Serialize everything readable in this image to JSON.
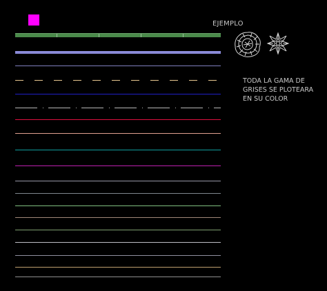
{
  "swatch": {
    "color": "#ff00ff"
  },
  "example": {
    "label": "EJEMPLO"
  },
  "note": {
    "lines": [
      "TODA LA GAMA DE",
      "GRISES SE PLOTEARA",
      "EN SU COLOR"
    ]
  },
  "symbols": [
    {
      "name": "shrub",
      "icon": "round-shrub-symbol"
    },
    {
      "name": "star-plant",
      "icon": "star-plant-symbol"
    }
  ],
  "lines": [
    {
      "color": "#4a8a4a",
      "style": "band-olive"
    },
    {
      "color": "#8a8ad8",
      "style": "band-lavender"
    },
    {
      "color": "#8080c0",
      "style": "solid"
    },
    {
      "color": "#e8c890",
      "style": "dashed"
    },
    {
      "color": "#2020c8",
      "style": "solid"
    },
    {
      "color": "#b8b8b8",
      "style": "dash-dot"
    },
    {
      "color": "#e01040",
      "style": "solid"
    },
    {
      "color": "#e0a090",
      "style": "solid"
    },
    {
      "color": "#10a0a0",
      "style": "solid"
    },
    {
      "color": "#c020b0",
      "style": "solid"
    },
    {
      "color": "#9898a8",
      "style": "solid"
    },
    {
      "color": "#808890",
      "style": "solid"
    },
    {
      "color": "#80c080",
      "style": "solid"
    },
    {
      "color": "#a08878",
      "style": "solid"
    },
    {
      "color": "#80a070",
      "style": "solid"
    },
    {
      "color": "#c0c0c8",
      "style": "solid"
    },
    {
      "color": "#9090a0",
      "style": "solid"
    },
    {
      "color": "#c0a070",
      "style": "solid"
    },
    {
      "color": "#909090",
      "style": "solid"
    }
  ]
}
